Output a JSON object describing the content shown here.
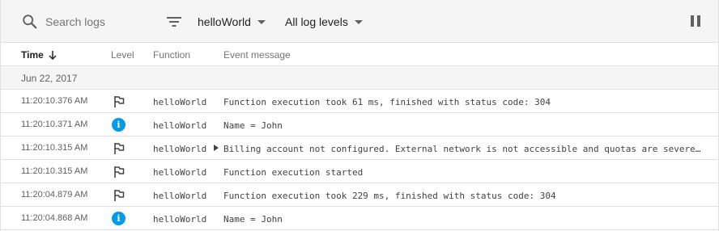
{
  "toolbar": {
    "search_placeholder": "Search logs",
    "function_filter": "helloWorld",
    "level_filter": "All log levels"
  },
  "columns": {
    "time": "Time",
    "level": "Level",
    "function": "Function",
    "message": "Event message"
  },
  "date_group": "Jun 22, 2017",
  "rows": [
    {
      "time": "11:20:10.376 AM",
      "level": "default",
      "function": "helloWorld",
      "message": "Function execution took 61 ms, finished with status code: 304",
      "expandable": false
    },
    {
      "time": "11:20:10.371 AM",
      "level": "info",
      "function": "helloWorld",
      "message": "Name = John",
      "expandable": false
    },
    {
      "time": "11:20:10.315 AM",
      "level": "default",
      "function": "helloWorld",
      "message": "Billing account not configured. External network is not accessible and quotas are severely limited. Configure billing account to remove these restrictions",
      "expandable": true
    },
    {
      "time": "11:20:10.315 AM",
      "level": "default",
      "function": "helloWorld",
      "message": "Function execution started",
      "expandable": false
    },
    {
      "time": "11:20:04.879 AM",
      "level": "default",
      "function": "helloWorld",
      "message": "Function execution took 229 ms, finished with status code: 304",
      "expandable": false
    },
    {
      "time": "11:20:04.868 AM",
      "level": "info",
      "function": "helloWorld",
      "message": "Name = John",
      "expandable": false
    }
  ],
  "colors": {
    "toolbar_bg": "#f5f5f5",
    "info_blue": "#039be5",
    "border": "#e0e0e0"
  },
  "icons": {
    "default_level": "flag-icon",
    "info_level": "info-icon",
    "search": "search-icon",
    "filter": "filter-list-icon",
    "pause": "pause-icon",
    "sort": "arrow-down-icon"
  }
}
